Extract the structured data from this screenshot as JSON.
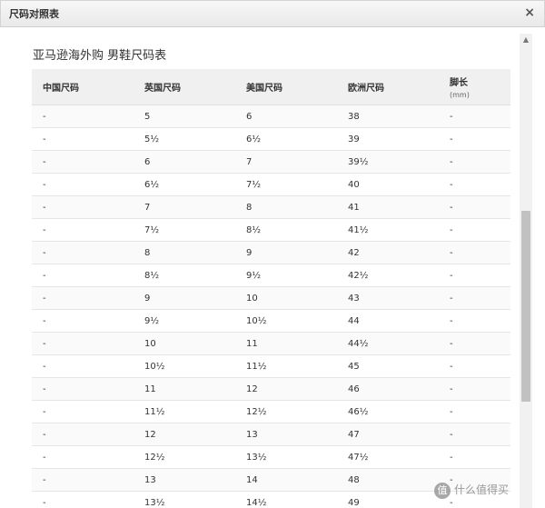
{
  "dialog": {
    "title": "尺码对照表",
    "close_label": "×"
  },
  "heading": "亚马逊海外购 男鞋尺码表",
  "table": {
    "headers": [
      "中国尺码",
      "英国尺码",
      "美国尺码",
      "欧洲尺码",
      "脚长"
    ],
    "unit": "(mm)",
    "rows": [
      [
        "-",
        "5",
        "6",
        "38",
        "-"
      ],
      [
        "-",
        "5½",
        "6½",
        "39",
        "-"
      ],
      [
        "-",
        "6",
        "7",
        "39½",
        "-"
      ],
      [
        "-",
        "6½",
        "7½",
        "40",
        "-"
      ],
      [
        "-",
        "7",
        "8",
        "41",
        "-"
      ],
      [
        "-",
        "7½",
        "8½",
        "41½",
        "-"
      ],
      [
        "-",
        "8",
        "9",
        "42",
        "-"
      ],
      [
        "-",
        "8½",
        "9½",
        "42½",
        "-"
      ],
      [
        "-",
        "9",
        "10",
        "43",
        "-"
      ],
      [
        "-",
        "9½",
        "10½",
        "44",
        "-"
      ],
      [
        "-",
        "10",
        "11",
        "44½",
        "-"
      ],
      [
        "-",
        "10½",
        "11½",
        "45",
        "-"
      ],
      [
        "-",
        "11",
        "12",
        "46",
        "-"
      ],
      [
        "-",
        "11½",
        "12½",
        "46½",
        "-"
      ],
      [
        "-",
        "12",
        "13",
        "47",
        "-"
      ],
      [
        "-",
        "12½",
        "13½",
        "47½",
        "-"
      ],
      [
        "-",
        "13",
        "14",
        "48",
        "-"
      ],
      [
        "-",
        "13½",
        "14½",
        "49",
        "-"
      ]
    ]
  },
  "scrollbar": {
    "up_arrow": "▲"
  },
  "watermark": {
    "badge": "值",
    "text": "什么值得买"
  }
}
